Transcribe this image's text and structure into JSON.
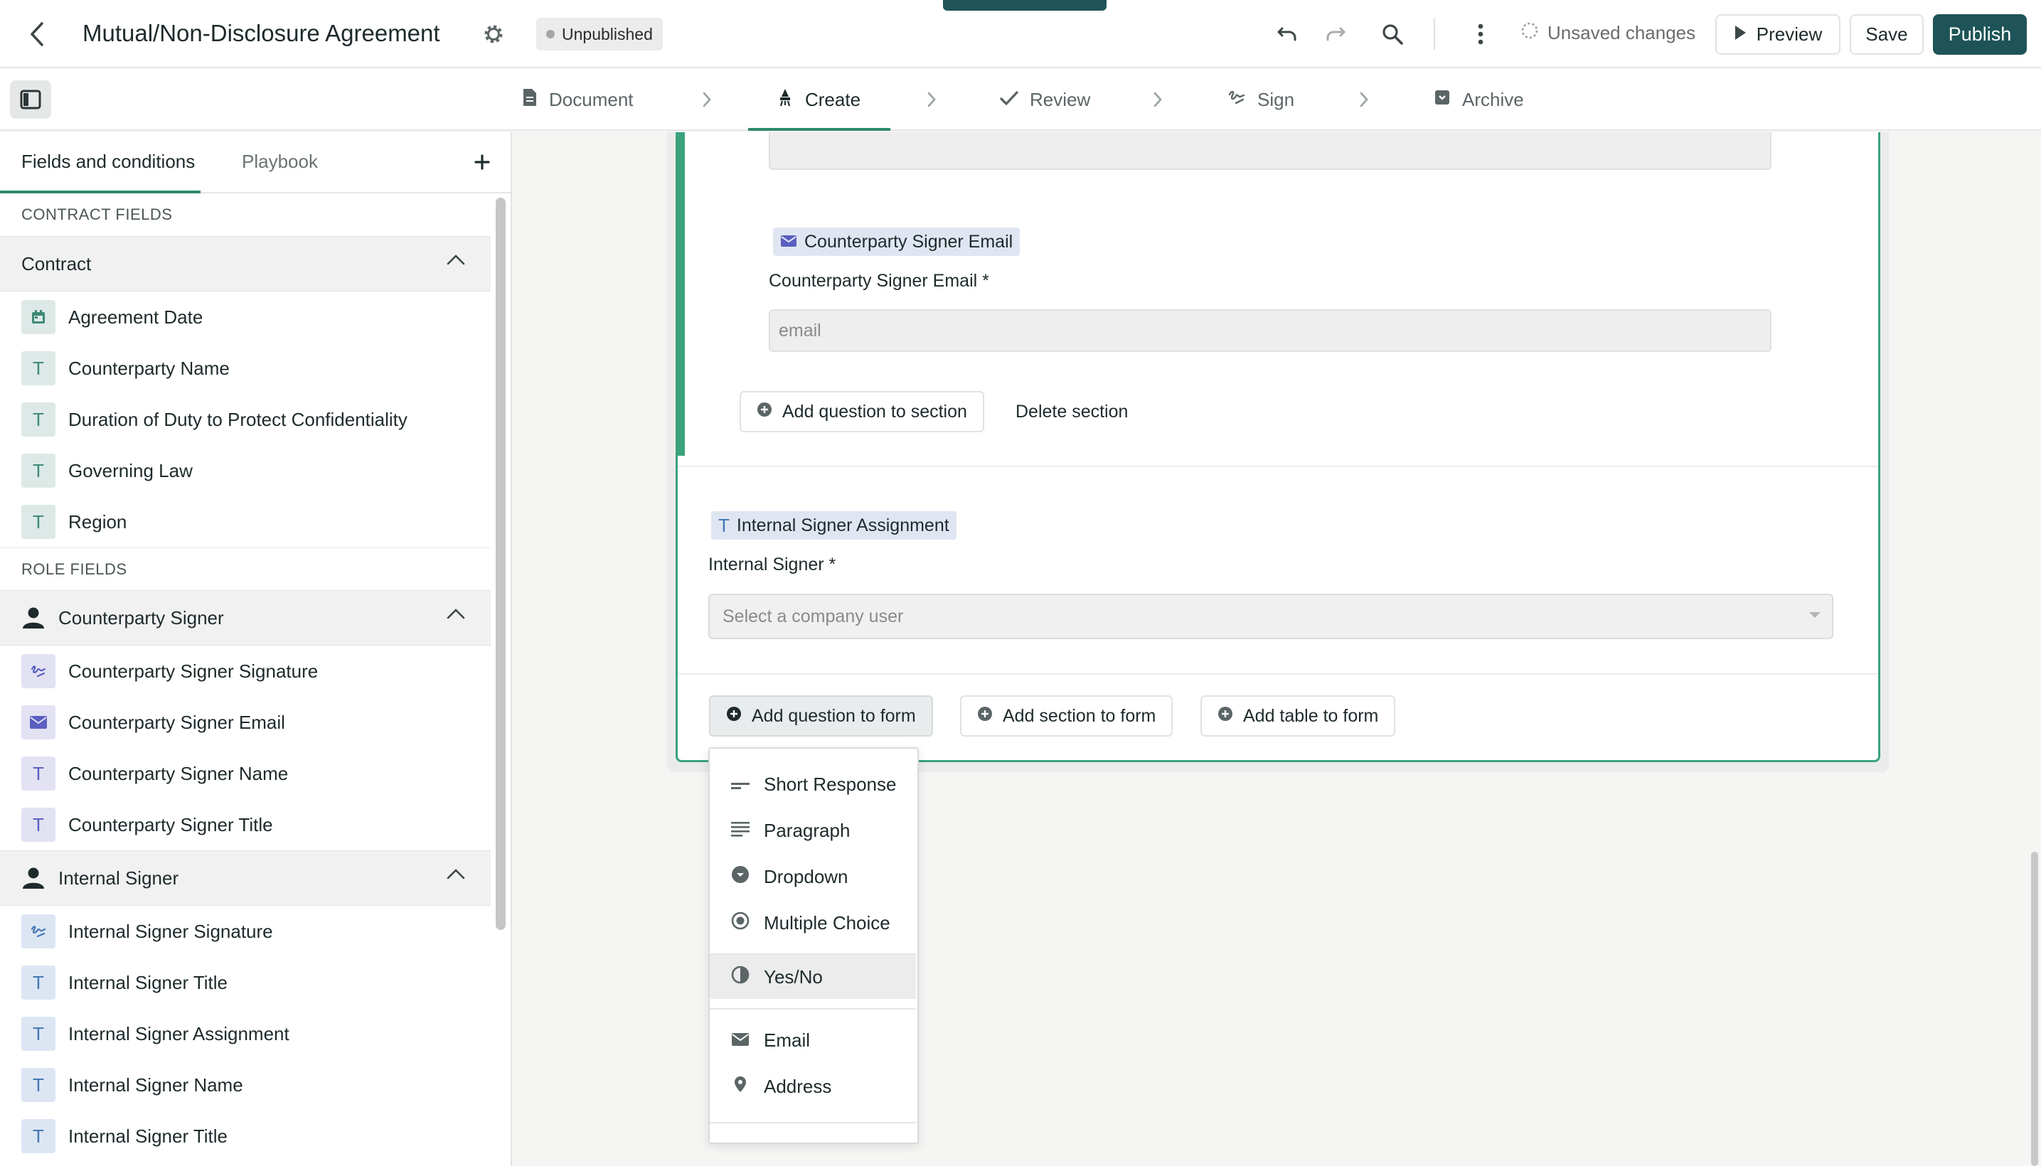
{
  "header": {
    "title": "Mutual/Non-Disclosure Agreement",
    "status_badge": "Unpublished",
    "unsaved_text": "Unsaved changes",
    "preview_label": "Preview",
    "save_label": "Save",
    "publish_label": "Publish"
  },
  "steps": [
    {
      "label": "Document",
      "icon": "document-icon"
    },
    {
      "label": "Create",
      "icon": "create-icon"
    },
    {
      "label": "Review",
      "icon": "check-icon"
    },
    {
      "label": "Sign",
      "icon": "signature-icon"
    },
    {
      "label": "Archive",
      "icon": "archive-icon"
    }
  ],
  "active_step": "Create",
  "sidebar": {
    "tabs": [
      "Fields and conditions",
      "Playbook"
    ],
    "contract_fields_label": "CONTRACT FIELDS",
    "role_fields_label": "ROLE FIELDS",
    "groups": [
      {
        "name": "Contract",
        "items": [
          {
            "label": "Agreement Date",
            "type": "date"
          },
          {
            "label": "Counterparty Name",
            "type": "text"
          },
          {
            "label": "Duration of Duty to Protect Confidentiality",
            "type": "text"
          },
          {
            "label": "Governing Law",
            "type": "text"
          },
          {
            "label": "Region",
            "type": "text"
          }
        ]
      },
      {
        "name": "Counterparty Signer",
        "items": [
          {
            "label": "Counterparty Signer Signature",
            "type": "signature"
          },
          {
            "label": "Counterparty Signer Email",
            "type": "email"
          },
          {
            "label": "Counterparty Signer Name",
            "type": "text"
          },
          {
            "label": "Counterparty Signer Title",
            "type": "text"
          }
        ]
      },
      {
        "name": "Internal Signer",
        "items": [
          {
            "label": "Internal Signer Signature",
            "type": "signature"
          },
          {
            "label": "Internal Signer Title",
            "type": "text"
          },
          {
            "label": "Internal Signer Assignment",
            "type": "text"
          },
          {
            "label": "Internal Signer Name",
            "type": "text"
          },
          {
            "label": "Internal Signer Title",
            "type": "text"
          }
        ]
      }
    ]
  },
  "form": {
    "email_tag": "Counterparty Signer Email",
    "email_label": "Counterparty Signer Email *",
    "email_placeholder": "email",
    "add_question_to_section": "Add question to section",
    "delete_section": "Delete section",
    "assignment_tag": "Internal Signer Assignment",
    "internal_signer_label": "Internal Signer *",
    "internal_signer_placeholder": "Select a company user",
    "add_question_to_form": "Add question to form",
    "add_section_to_form": "Add section to form",
    "add_table_to_form": "Add table to form"
  },
  "question_menu": [
    {
      "label": "Short Response",
      "icon": "short-response-icon"
    },
    {
      "label": "Paragraph",
      "icon": "paragraph-icon"
    },
    {
      "label": "Dropdown",
      "icon": "dropdown-icon"
    },
    {
      "label": "Multiple Choice",
      "icon": "multiple-choice-icon"
    },
    {
      "label": "Yes/No",
      "icon": "yes-no-icon"
    },
    {
      "label": "Email",
      "icon": "email-icon"
    },
    {
      "label": "Address",
      "icon": "location-icon"
    }
  ],
  "highlighted_menu_item": "Yes/No",
  "colors": {
    "brand": "#1e5457",
    "accent_green": "#3aa37b",
    "text_icon_bg": "#dde9e6",
    "signer_icon_bg": "#e2e2f3",
    "internal_icon_bg": "#dce6f3"
  }
}
